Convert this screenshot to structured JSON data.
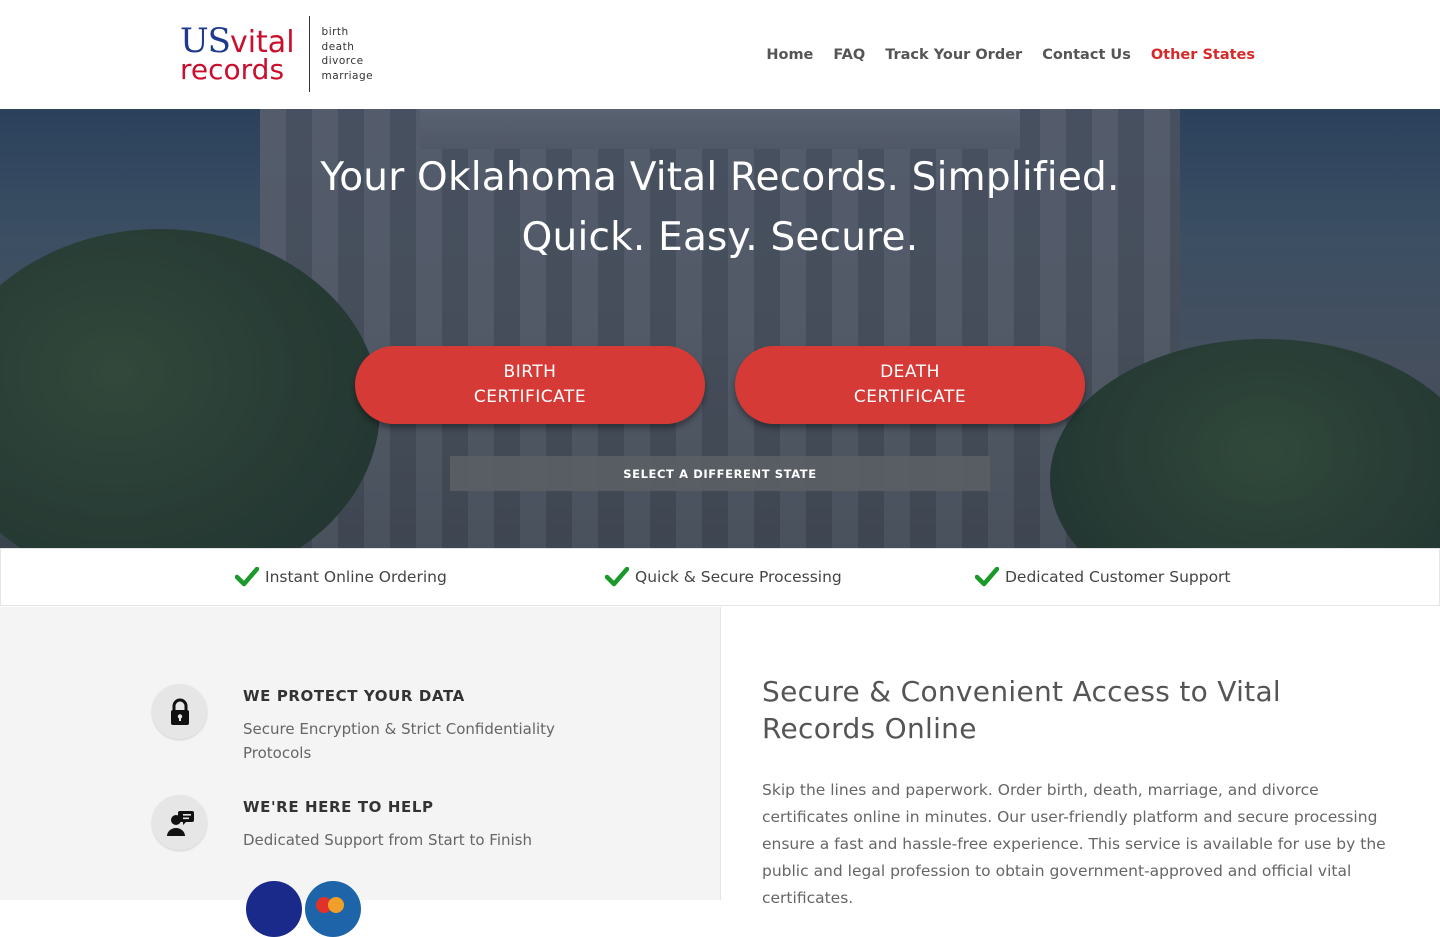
{
  "header": {
    "logo": {
      "us": "US",
      "vital": "vital",
      "records": "records",
      "tags": [
        "birth",
        "death",
        "divorce",
        "marriage"
      ]
    },
    "nav": [
      {
        "label": "Home"
      },
      {
        "label": "FAQ"
      },
      {
        "label": "Track Your Order"
      },
      {
        "label": "Contact Us"
      },
      {
        "label": "Other States"
      }
    ],
    "accent_color": "#d62a2a"
  },
  "hero": {
    "title_line1": "Your Oklahoma Vital Records. Simplified.",
    "title_line2": "Quick. Easy. Secure.",
    "birth_button": {
      "line1": "BIRTH",
      "line2": "CERTIFICATE"
    },
    "death_button": {
      "line1": "DEATH",
      "line2": "CERTIFICATE"
    },
    "state_button": "SELECT A DIFFERENT STATE",
    "button_color": "#d63a36"
  },
  "features": [
    {
      "label": "Instant Online Ordering",
      "icon": "check-icon"
    },
    {
      "label": "Quick & Secure Processing",
      "icon": "check-icon"
    },
    {
      "label": "Dedicated Customer Support",
      "icon": "check-icon"
    }
  ],
  "info": [
    {
      "title": "WE PROTECT YOUR DATA",
      "desc": "Secure Encryption & Strict Confidentiality Protocols",
      "icon": "lock-icon"
    },
    {
      "title": "WE'RE HERE TO HELP",
      "desc": "Dedicated Support from Start to Finish",
      "icon": "support-agent-icon"
    }
  ],
  "content": {
    "title": "Secure & Convenient Access to Vital Records Online",
    "body": "Skip the lines and paperwork. Order birth, death, marriage, and divorce certificates online in minutes. Our user-friendly platform and secure processing ensure a fast and hassle-free experience. This service is available for use by the public and legal profession to obtain government-approved and official vital certificates."
  }
}
